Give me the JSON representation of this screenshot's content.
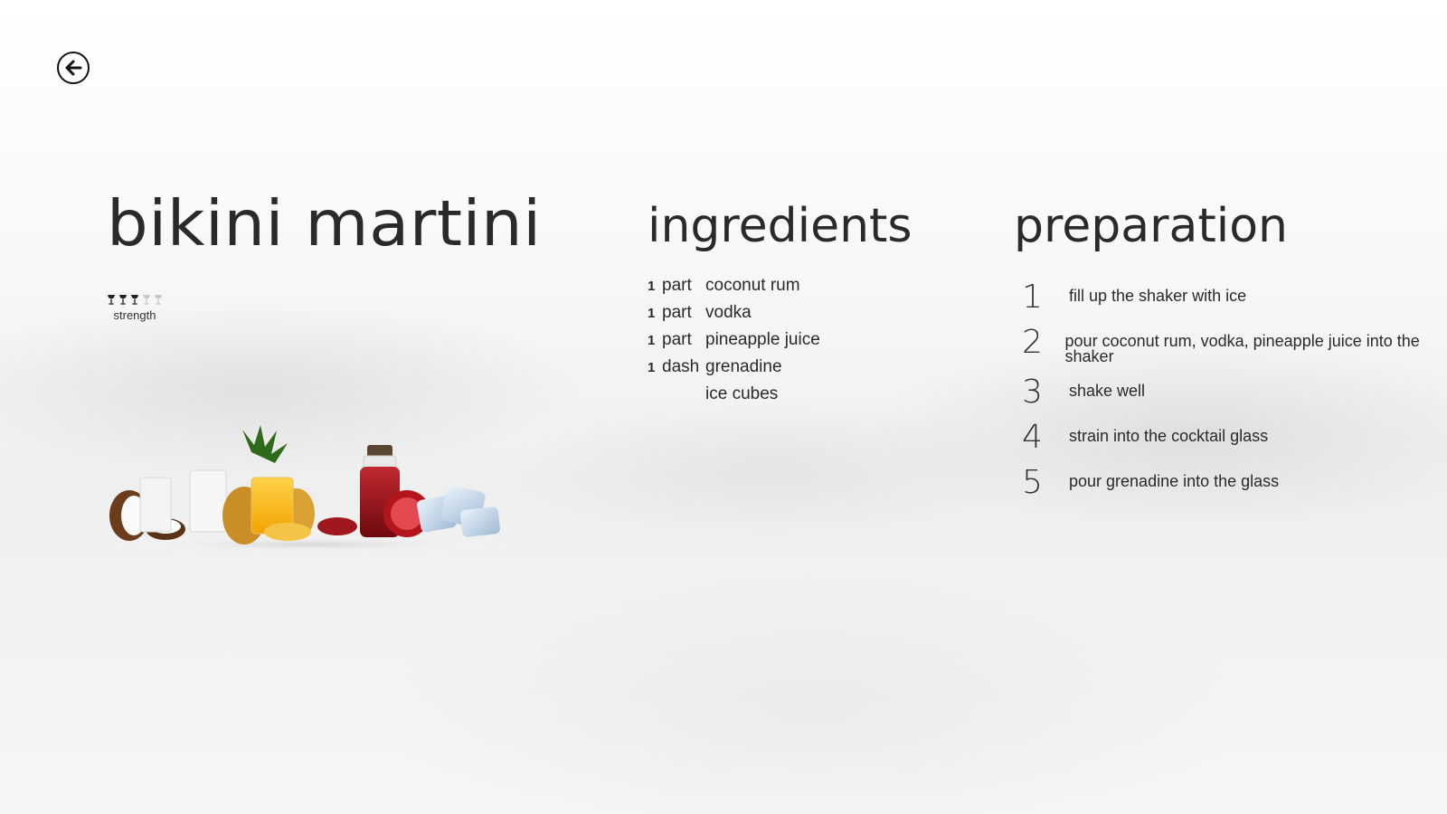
{
  "back_button": {
    "icon": "arrow-left-icon"
  },
  "recipe": {
    "title": "bikini martini",
    "strength": {
      "label": "strength",
      "value": 3,
      "max": 5
    }
  },
  "ingredients": {
    "heading": "ingredients",
    "items": [
      {
        "qty": "1",
        "unit": "part",
        "name": "coconut rum"
      },
      {
        "qty": "1",
        "unit": "part",
        "name": "vodka"
      },
      {
        "qty": "1",
        "unit": "part",
        "name": "pineapple juice"
      },
      {
        "qty": "1",
        "unit": "dash",
        "name": "grenadine"
      },
      {
        "qty": "",
        "unit": "",
        "name": "ice cubes"
      }
    ]
  },
  "preparation": {
    "heading": "preparation",
    "steps": [
      {
        "num": "1",
        "text": "fill up the shaker with ice"
      },
      {
        "num": "2",
        "text": "pour coconut rum, vodka, pineapple juice into the shaker"
      },
      {
        "num": "3",
        "text": "shake well"
      },
      {
        "num": "4",
        "text": "strain into the cocktail glass"
      },
      {
        "num": "5",
        "text": "pour grenadine into the glass"
      }
    ]
  },
  "colors": {
    "text": "#2a2a2a",
    "glass_filled": "#222222",
    "glass_empty": "#c8c8c8"
  }
}
